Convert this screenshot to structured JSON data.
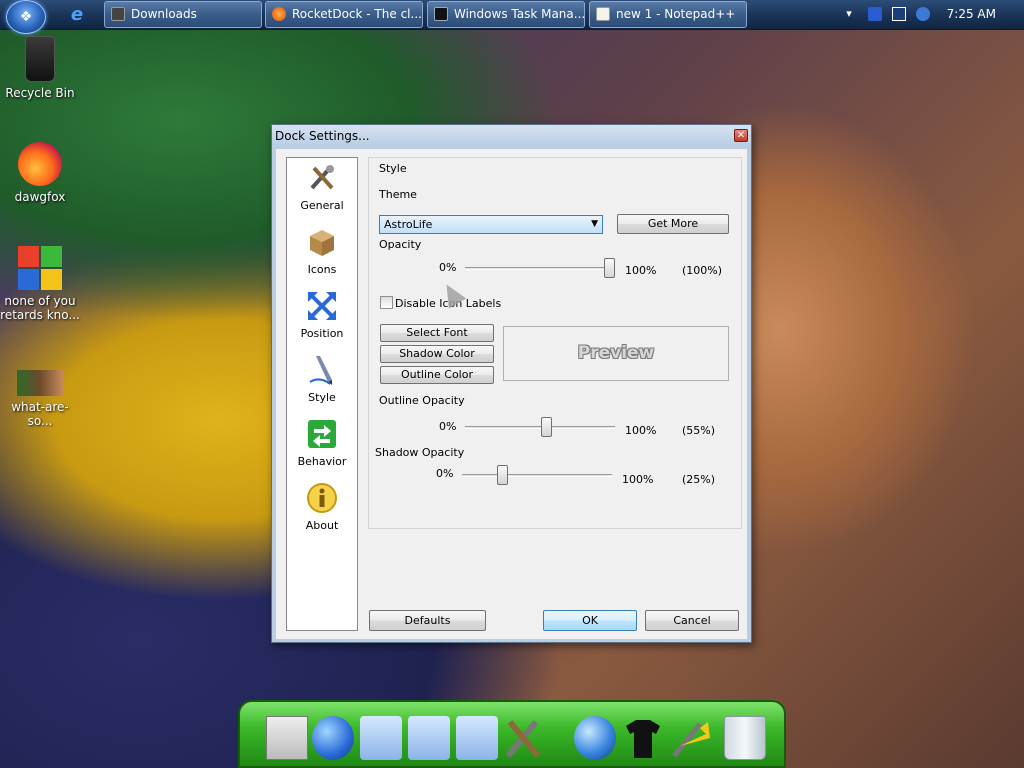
{
  "taskbar": {
    "buttons": [
      {
        "label": "Downloads"
      },
      {
        "label": "RocketDock - The cl..."
      },
      {
        "label": "Windows Task Mana..."
      },
      {
        "label": "new 1 - Notepad++"
      }
    ],
    "clock": "7:25 AM"
  },
  "desktop": {
    "icons": [
      {
        "label": "Recycle Bin",
        "icon": "recycle-bin-icon"
      },
      {
        "label": "dawgfox",
        "icon": "firefox-icon"
      },
      {
        "label": "none of you retards kno...",
        "icon": "windows-logo-icon"
      },
      {
        "label": "what-are-so...",
        "icon": "image-thumbnail-icon"
      }
    ]
  },
  "dialog": {
    "title": "Dock Settings...",
    "sidebar": [
      {
        "label": "General",
        "icon": "tools-icon"
      },
      {
        "label": "Icons",
        "icon": "box-icon"
      },
      {
        "label": "Position",
        "icon": "position-arrows-icon"
      },
      {
        "label": "Style",
        "icon": "pen-icon"
      },
      {
        "label": "Behavior",
        "icon": "behavior-arrows-icon"
      },
      {
        "label": "About",
        "icon": "info-icon"
      }
    ],
    "style": {
      "group_label": "Style",
      "theme_label": "Theme",
      "theme_value": "AstroLife",
      "get_more": "Get More",
      "opacity_label": "Opacity",
      "opacity_min": "0%",
      "opacity_max": "100%",
      "opacity_value": "(100%)",
      "opacity_fraction": 1.0,
      "disable_labels": "Disable Icon Labels",
      "disable_labels_checked": false,
      "select_font": "Select Font",
      "shadow_color": "Shadow Color",
      "outline_color": "Outline Color",
      "preview": "Preview",
      "outline_opacity_label": "Outline Opacity",
      "outline_min": "0%",
      "outline_max": "100%",
      "outline_value": "(55%)",
      "outline_fraction": 0.55,
      "shadow_opacity_label": "Shadow Opacity",
      "shadow_min": "0%",
      "shadow_max": "100%",
      "shadow_value": "(25%)",
      "shadow_fraction": 0.25
    },
    "buttons": {
      "defaults": "Defaults",
      "ok": "OK",
      "cancel": "Cancel"
    }
  },
  "dock": {
    "items": [
      "document-viewer-icon",
      "globe-docs-icon",
      "folder-icon",
      "music-folder-icon",
      "pictures-folder-icon",
      "tools-icon",
      "internet-globe-icon",
      "tshirt-icon",
      "tools-arrow-icon",
      "recycle-bin-icon"
    ]
  }
}
